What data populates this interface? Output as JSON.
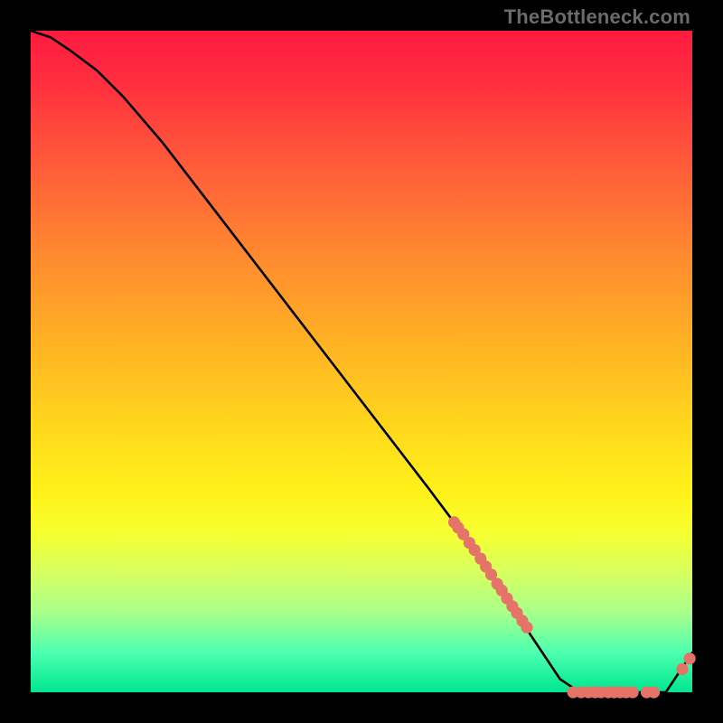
{
  "watermark": "TheBottleneck.com",
  "colors": {
    "gradient_top": "#ff1a40",
    "gradient_mid": "#ffd81c",
    "gradient_bottom": "#00e68f",
    "curve": "#000000",
    "points": "#e57367",
    "background": "#000000"
  },
  "chart_data": {
    "type": "line",
    "title": "",
    "xlabel": "",
    "ylabel": "",
    "xlim": [
      0,
      100
    ],
    "ylim": [
      0,
      100
    ],
    "grid": false,
    "legend": false,
    "series": [
      {
        "name": "curve",
        "x": [
          0,
          3,
          6,
          10,
          14,
          20,
          30,
          40,
          50,
          60,
          66,
          70,
          74,
          78,
          80,
          83,
          86,
          90,
          93,
          96,
          98,
          100
        ],
        "y": [
          100,
          99,
          97,
          94,
          90,
          83,
          70,
          57,
          44,
          31,
          23,
          17,
          11,
          5,
          2,
          0,
          0,
          0,
          0,
          0,
          3,
          6
        ]
      }
    ],
    "scatter": [
      {
        "name": "cluster-slope",
        "x": [
          64.0,
          64.6,
          65.4,
          66.3,
          67.1,
          68.0,
          68.8,
          69.6,
          70.5,
          71.2,
          72.0,
          72.8,
          73.5,
          74.3,
          75.0
        ],
        "y": [
          25.7,
          24.9,
          23.9,
          22.6,
          21.5,
          20.2,
          19.0,
          17.8,
          16.4,
          15.4,
          14.2,
          13.0,
          12.0,
          10.8,
          9.8
        ]
      },
      {
        "name": "cluster-flat",
        "x": [
          82.0,
          83.2,
          84.3,
          85.3,
          86.2,
          87.3,
          88.2,
          89.1,
          90.0,
          91.0,
          93.1,
          94.2
        ],
        "y": [
          0.0,
          0.0,
          0.0,
          0.0,
          0.0,
          0.0,
          0.0,
          0.0,
          0.0,
          0.0,
          0.0,
          0.0
        ]
      },
      {
        "name": "tail-points",
        "x": [
          98.5,
          99.6
        ],
        "y": [
          3.5,
          5.1
        ]
      }
    ]
  }
}
